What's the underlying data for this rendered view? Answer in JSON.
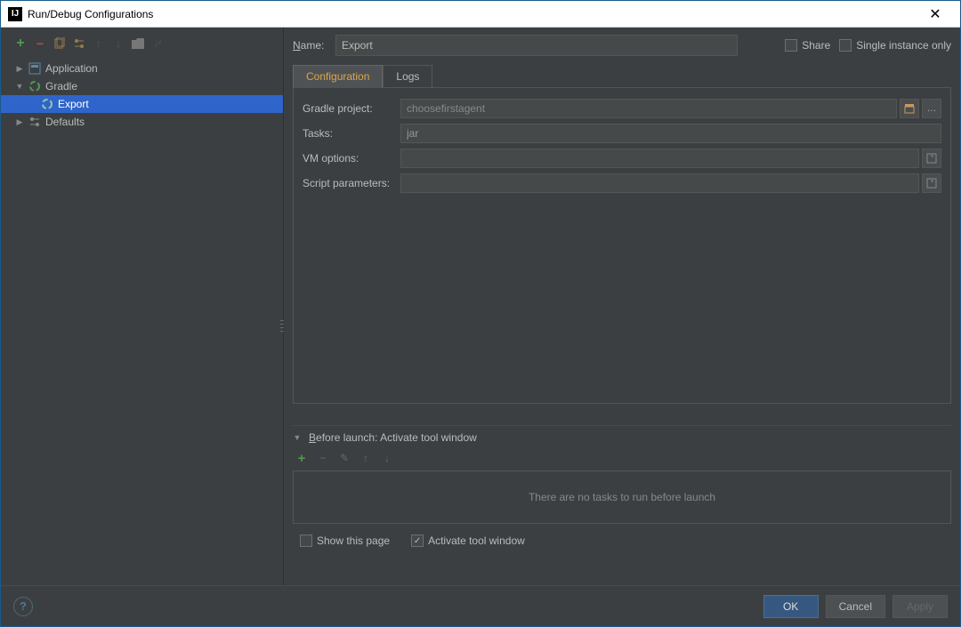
{
  "window": {
    "title": "Run/Debug Configurations"
  },
  "tree": {
    "application": "Application",
    "gradle": "Gradle",
    "export": "Export",
    "defaults": "Defaults"
  },
  "form": {
    "name_label": "Name:",
    "name_value": "Export",
    "share_label": "Share",
    "single_instance_label": "Single instance only",
    "tab_configuration": "Configuration",
    "tab_logs": "Logs",
    "gradle_project_label": "Gradle project:",
    "gradle_project_value": "choosefirstagent",
    "tasks_label": "Tasks:",
    "tasks_value": "jar",
    "vm_options_label": "VM options:",
    "vm_options_value": "",
    "script_params_label": "Script parameters:",
    "script_params_value": ""
  },
  "before_launch": {
    "header": "Before launch: Activate tool window",
    "empty": "There are no tasks to run before launch"
  },
  "bottom": {
    "show_this_page": "Show this page",
    "activate_tool_window": "Activate tool window"
  },
  "buttons": {
    "ok": "OK",
    "cancel": "Cancel",
    "apply": "Apply"
  }
}
